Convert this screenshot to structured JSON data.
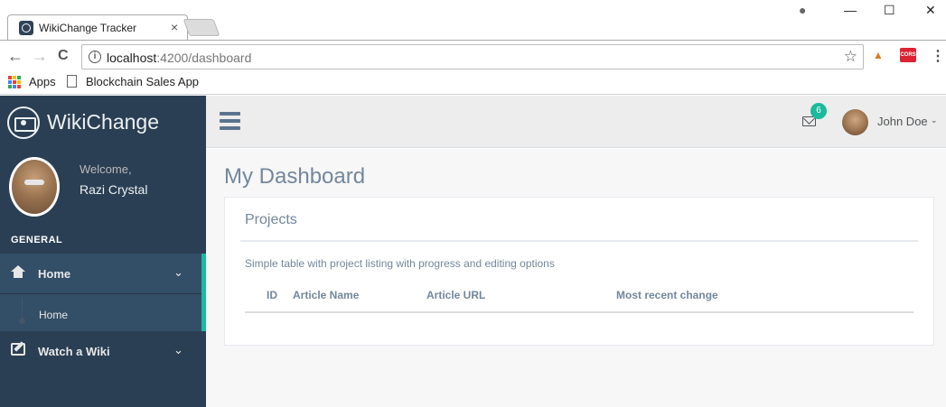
{
  "browser": {
    "tab_title": "WikiChange Tracker",
    "tab_close": "×",
    "window_controls": {
      "profile": "●",
      "minimize": "—",
      "maximize": "☐",
      "close": "✕"
    },
    "nav": {
      "back": "←",
      "forward": "→",
      "reload": "C"
    },
    "url_host": "localhost",
    "url_path": ":4200/dashboard",
    "info_icon": "i",
    "star_icon": "☆",
    "extensions": [
      "metamask-icon",
      "cors-icon"
    ],
    "ext_cors_label": "CORS",
    "menu_dots": "⋮",
    "bookmarks": {
      "apps_label": "Apps",
      "bookmark_1": "Blockchain Sales App"
    }
  },
  "sidebar": {
    "brand": "WikiChange",
    "welcome": "Welcome,",
    "username": "Razi Crystal",
    "section_title": "GENERAL",
    "menu": [
      {
        "label": "Home",
        "icon": "home-icon",
        "chevron": "⌄",
        "expanded": true,
        "submenu": [
          {
            "label": "Home"
          }
        ]
      },
      {
        "label": "Watch a Wiki",
        "icon": "edit-icon",
        "chevron": "⌄"
      }
    ]
  },
  "topnav": {
    "mail_count": "6",
    "user_name": "John Doe",
    "user_caret": "⌄"
  },
  "main": {
    "page_title": "My Dashboard",
    "panel": {
      "title": "Projects",
      "description": "Simple table with project listing with progress and editing options",
      "columns": [
        "ID",
        "Article Name",
        "Article URL",
        "Most recent change"
      ]
    }
  },
  "colors": {
    "sidebar_bg": "#2a3f54",
    "accent": "#1abb9c",
    "text_muted": "#73879c"
  }
}
